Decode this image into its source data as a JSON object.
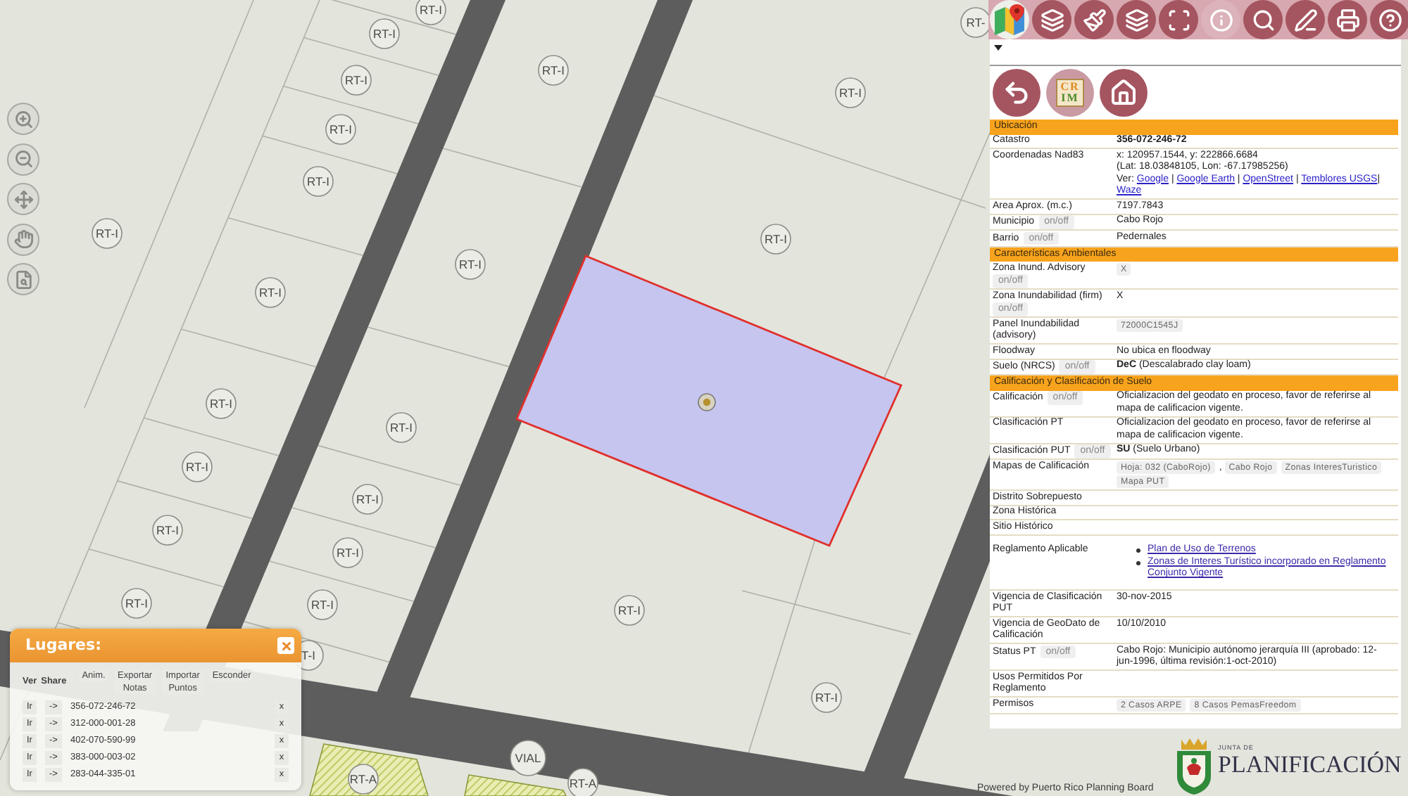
{
  "map": {
    "labels": [
      "RT-I",
      "RT-",
      "RT-I",
      "RT-I",
      "RT-I",
      "RT-I",
      "RT-I",
      "RT-I",
      "RT-I",
      "RT-I",
      "RT-I",
      "RT-I",
      "RT-I",
      "RT-I",
      "RT-I",
      "RT-I",
      "RT-I",
      "RT-I",
      "RT-I",
      "RT-I",
      "RT-I",
      "T-I",
      "RT-I",
      "VIAL",
      "RT-A",
      "RT-A"
    ]
  },
  "panel_tools": {
    "logo_lines": [
      "CR",
      "IM"
    ]
  },
  "info_panel": {
    "sections": [
      {
        "title": "Ubicación",
        "rows": [
          {
            "label": "Catastro",
            "value": [
              {
                "kind": "strong",
                "text": "356-072-246-72"
              }
            ]
          },
          {
            "label": "Coordenadas Nad83",
            "value": [
              {
                "kind": "line",
                "text": "x: 120957.1544, y: 222866.6684"
              },
              {
                "kind": "line",
                "text": "(Lat: 18.03848105, Lon: -67.17985256)"
              },
              {
                "kind": "text",
                "text": "Ver:"
              },
              {
                "kind": "link",
                "text": "Google"
              },
              {
                "kind": "sep",
                "text": "|"
              },
              {
                "kind": "link",
                "text": "Google Earth"
              },
              {
                "kind": "sep",
                "text": "|"
              },
              {
                "kind": "link",
                "text": "OpenStreet"
              },
              {
                "kind": "sep",
                "text": "|"
              },
              {
                "kind": "link",
                "text": "Temblores USGS"
              },
              {
                "kind": "sep_tight",
                "text": "|"
              },
              {
                "kind": "link",
                "text": "Waze"
              }
            ]
          },
          {
            "label": "Area Aprox. (m.c.)",
            "value": [
              {
                "kind": "text",
                "text": "7197.7843"
              }
            ]
          },
          {
            "label": "Municipio",
            "toggle": "on/off",
            "value": [
              {
                "kind": "text",
                "text": "Cabo Rojo"
              }
            ]
          },
          {
            "label": "Barrio",
            "toggle": "on/off",
            "value": [
              {
                "kind": "text",
                "text": "Pedernales"
              }
            ]
          }
        ]
      },
      {
        "title": "Características Ambientales",
        "rows": [
          {
            "label": "Zona Inund. Advisory",
            "toggle": "on/off",
            "value": [
              {
                "kind": "badge",
                "text": "X"
              }
            ]
          },
          {
            "label": "Zona Inundabilidad (firm)",
            "toggle": "on/off",
            "value": [
              {
                "kind": "text",
                "text": "X"
              }
            ]
          },
          {
            "label": "Panel Inundabilidad (advisory)",
            "value": [
              {
                "kind": "badge",
                "text": "72000C1545J"
              }
            ]
          },
          {
            "label": "Floodway",
            "value": [
              {
                "kind": "text",
                "text": "No ubica en floodway"
              }
            ]
          },
          {
            "label": "Suelo (NRCS)",
            "toggle": "on/off",
            "value": [
              {
                "kind": "text",
                "text": "**DeC** (Descalabrado clay loam)"
              }
            ]
          }
        ]
      },
      {
        "title": "Calificación y Clasificación de Suelo",
        "rows": [
          {
            "label": "Calificación",
            "toggle": "on/off",
            "value": [
              {
                "kind": "text",
                "text": "Oficializacion del geodato en proceso, favor de referirse al mapa de calificacion vigente."
              }
            ]
          },
          {
            "label": "Clasificación PT",
            "value": [
              {
                "kind": "text",
                "text": "Oficializacion del geodato en proceso, favor de referirse al mapa de calificacion vigente."
              }
            ]
          },
          {
            "label": "Clasificación PUT",
            "toggle": "on/off",
            "value": [
              {
                "kind": "text",
                "text": "**SU** (Suelo Urbano)"
              }
            ]
          },
          {
            "label": "Mapas de Calificación",
            "value": [
              {
                "kind": "badge",
                "text": "Hoja: 032 (CaboRojo)"
              },
              {
                "kind": "text",
                "text": ","
              },
              {
                "kind": "badge",
                "text": "Cabo Rojo"
              },
              {
                "kind": "badge",
                "text": "Zonas InteresTuristico"
              },
              {
                "kind": "badge",
                "text": "Mapa PUT"
              }
            ]
          },
          {
            "label": "Distrito Sobrepuesto"
          },
          {
            "label": "Zona Histórica"
          },
          {
            "label": "Sitio Histórico"
          },
          {
            "label": "Reglamento Aplicable",
            "value": [
              {
                "kind": "bullets",
                "items": [
                  "Plan de Uso de Terrenos",
                  "Zonas de Interes Turístico incorporado en Reglamento Conjunto Vigente"
                ]
              }
            ]
          },
          {
            "label": "Vigencia de Clasificación PUT",
            "value": [
              {
                "kind": "text",
                "text": "30-nov-2015"
              }
            ]
          },
          {
            "label": "Vigencia de GeoDato de Calificación",
            "value": [
              {
                "kind": "text",
                "text": "10/10/2010"
              }
            ]
          },
          {
            "label": "Status PT",
            "toggle": "on/off",
            "value": [
              {
                "kind": "text",
                "text": "Cabo Rojo: Municipio autónomo jerarquía III (aprobado: 12-jun-1996, última revisión:1-oct-2010)"
              }
            ]
          },
          {
            "label": "Usos Permitidos Por Reglamento"
          },
          {
            "label": "Permisos",
            "value": [
              {
                "kind": "badge",
                "text": "2 Casos ARPE"
              },
              {
                "kind": "badge",
                "text": "8 Casos PemasFreedom"
              }
            ]
          }
        ]
      }
    ]
  },
  "places": {
    "title": "Lugares:",
    "columns": [
      "Ver",
      "Share"
    ],
    "actions": [
      "Anim.",
      "Exportar Notas",
      "Importar Puntos",
      "Esconder"
    ],
    "rows": [
      {
        "go": "Ir",
        "share": "->",
        "id": "356-072-246-72",
        "remove": "x"
      },
      {
        "go": "Ir",
        "share": "->",
        "id": "312-000-001-28",
        "remove": "x"
      },
      {
        "go": "Ir",
        "share": "->",
        "id": "402-070-590-99",
        "remove": "x"
      },
      {
        "go": "Ir",
        "share": "->",
        "id": "383-000-003-02",
        "remove": "x"
      },
      {
        "go": "Ir",
        "share": "->",
        "id": "283-044-335-01",
        "remove": "x"
      }
    ]
  },
  "footer": {
    "credit": "Powered by Puerto Rico Planning Board",
    "agency_prefix": "JUNTA DE",
    "agency_name": "PLANIFICACIÓN"
  }
}
